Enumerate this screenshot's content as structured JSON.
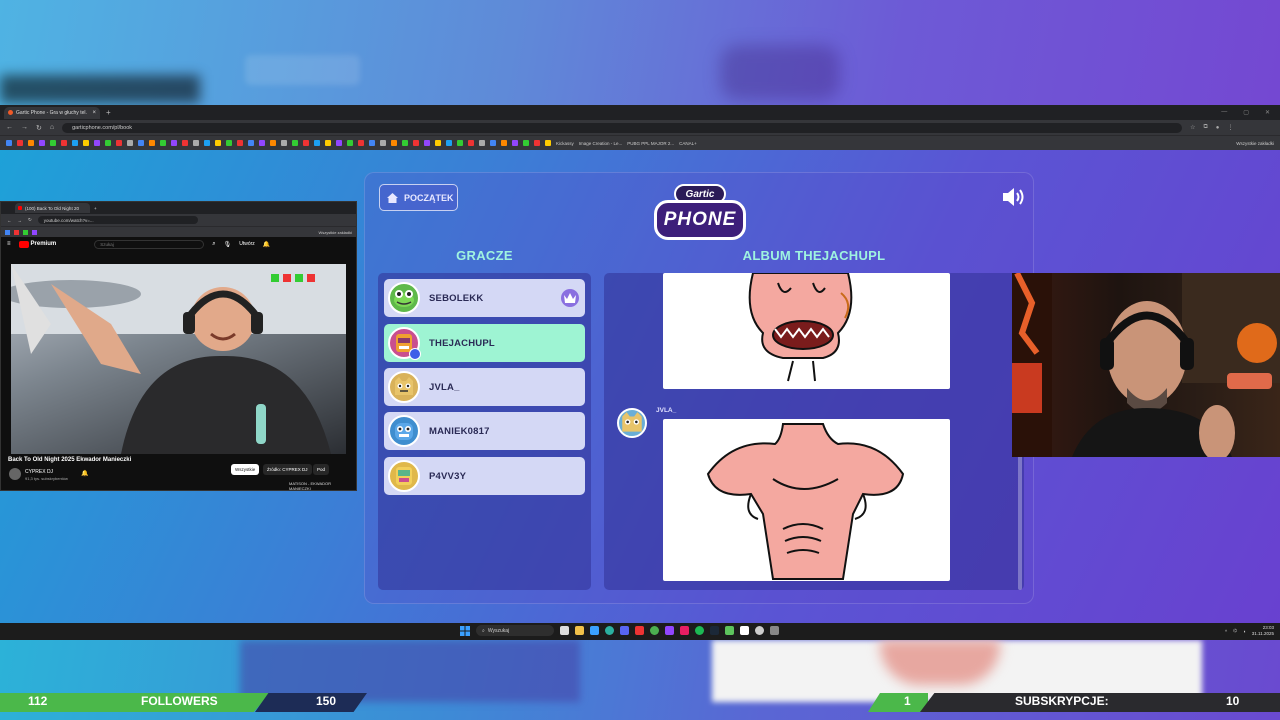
{
  "browser": {
    "tab_title": "Gartic Phone - Gra w głuchy tel.",
    "url": "garticphone.com/pl/book",
    "bookmarks": [
      "Kickassy",
      "Image Creation - Le...",
      "PUBG PPL MAJOR 2...",
      "CANAL+"
    ],
    "bookmarks_right": "Wszystkie zakładki"
  },
  "game": {
    "home_label": "POCZĄTEK",
    "logo_top": "Gartic",
    "logo_bottom": "PHONE",
    "players_heading": "GRACZE",
    "album_heading": "ALBUM THEJACHUPL",
    "players": [
      {
        "name": "SEBOLEKK",
        "host": true,
        "active": false,
        "color": "#5fb94a"
      },
      {
        "name": "THEJACHUPL",
        "host": false,
        "active": true,
        "color": "#c94f8f"
      },
      {
        "name": "JVLA_",
        "host": false,
        "active": false,
        "color": "#d9b25a"
      },
      {
        "name": "MANIEK0817",
        "host": false,
        "active": false,
        "color": "#3f8ecf"
      },
      {
        "name": "P4VV3Y",
        "host": false,
        "active": false,
        "color": "#e0b84a"
      }
    ],
    "album_post_author": "JVLA_"
  },
  "youtube": {
    "tab_title": "(100) Back To Old Night 20",
    "url": "youtube.com/watch?v=...",
    "logo": "Premium",
    "search_placeholder": "Szukaj",
    "create_label": "Utwórz",
    "bookmarks_right": "Wszystkie zakładki",
    "video_title": "Back To Old Night 2025 Ekwador Manieczki",
    "channel": "CYPREX DJ",
    "subs": "91,3 tys. subskrybentów",
    "chips": [
      "Wszystkie",
      "Źródło: CYPREX DJ",
      "Pod"
    ],
    "side_title": "MATISON - EKWADOR MANIECZKI"
  },
  "taskbar": {
    "search_placeholder": "Wyszukaj",
    "time": "23:03",
    "date": "31.11.2025"
  },
  "stats": {
    "followers_current": "112",
    "followers_label": "FOLLOWERS",
    "followers_goal": "150",
    "subs_current": "1",
    "subs_label": "SUBSKRYPCJE:",
    "subs_goal": "10"
  },
  "colors": {
    "accent_mint": "#9ef4d3",
    "heading_mint": "#9ff3e0",
    "player_card": "#d4d8f5",
    "bar_green": "#4bb84a"
  }
}
